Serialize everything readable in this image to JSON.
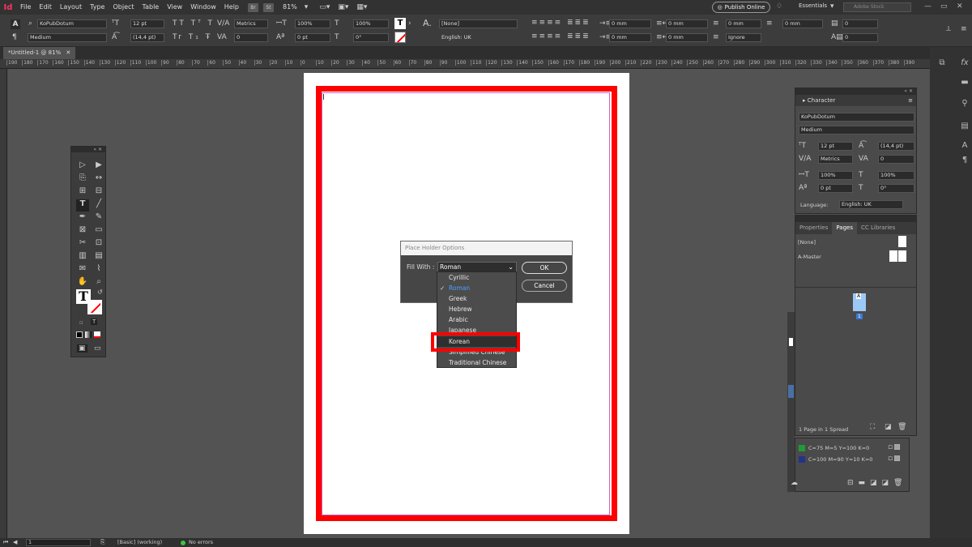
{
  "app": {
    "logo": "Id"
  },
  "menubar": {
    "items": [
      "File",
      "Edit",
      "Layout",
      "Type",
      "Object",
      "Table",
      "View",
      "Window",
      "Help"
    ],
    "br": "Br",
    "st": "St",
    "zoom": "81%",
    "publish": "Publish Online",
    "workspace": "Essentials",
    "stock_placeholder": "Adobe Stock"
  },
  "control": {
    "font": "KoPubDotum",
    "style": "Medium",
    "size": "12 pt",
    "leading": "(14,4 pt)",
    "kerning": "Metrics",
    "tracking": "0",
    "vscale": "100%",
    "hscale": "100%",
    "baseline": "0 pt",
    "skew": "0°",
    "charstyle": "[None]",
    "language": "English: UK",
    "mm1": "0 mm",
    "mm2": "0 mm",
    "mm3": "0 mm",
    "mm4": "0 mm",
    "mm5": "0 mm",
    "mm6": "0 mm",
    "zero1": "0",
    "zero2": "0",
    "ignore": "Ignore"
  },
  "doc": {
    "tab": "*Untitled-1 @ 81%",
    "close": "✕"
  },
  "ruler": {
    "ticks": [
      "190",
      "180",
      "170",
      "160",
      "150",
      "140",
      "130",
      "120",
      "110",
      "100",
      "90",
      "80",
      "70",
      "60",
      "50",
      "40",
      "30",
      "20",
      "10",
      "0",
      "10",
      "20",
      "30",
      "40",
      "50",
      "60",
      "70",
      "80",
      "90",
      "100",
      "110",
      "120",
      "130",
      "140",
      "150",
      "160",
      "170",
      "180",
      "190",
      "200",
      "210",
      "220",
      "230",
      "240",
      "250",
      "260",
      "270",
      "280",
      "290",
      "300",
      "310",
      "320",
      "330",
      "340",
      "350",
      "360",
      "370",
      "380",
      "390"
    ]
  },
  "dialog": {
    "title": "Place Holder Options",
    "fill_label": "Fill With :",
    "fill_value": "Roman",
    "ok": "OK",
    "cancel": "Cancel",
    "options": [
      "Cyrillic",
      "Roman",
      "Greek",
      "Hebrew",
      "Arabic",
      "Japanese",
      "Korean",
      "Simplified Chinese",
      "Traditional Chinese"
    ],
    "selected": "Roman",
    "highlighted": "Korean"
  },
  "character_panel": {
    "title": "Character",
    "font": "KoPubDotum",
    "style": "Medium",
    "size": "12 pt",
    "leading": "(14,4 pt)",
    "kerning": "Metrics",
    "tracking": "0",
    "vscale": "100%",
    "hscale": "100%",
    "baseline": "0 pt",
    "skew": "0°",
    "language_label": "Language:",
    "language": "English: UK"
  },
  "pages_panel": {
    "tabs": [
      "Properties",
      "Pages",
      "CC Libraries"
    ],
    "none": "[None]",
    "master": "A-Master",
    "page_letter": "A",
    "page_number": "1",
    "summary": "1 Page in 1 Spread"
  },
  "swatches": [
    {
      "label": "C=75 M=5 Y=100 K=0",
      "color": "#1f9a3a"
    },
    {
      "label": "C=100 M=90 Y=10 K=0",
      "color": "#23338a"
    }
  ],
  "status": {
    "page": "1",
    "style": "[Basic] (working)",
    "errors": "No errors"
  },
  "colors": {
    "accent": "#ff0000",
    "dropdown_select": "#3ea0ff",
    "guide": "#c466c4"
  }
}
